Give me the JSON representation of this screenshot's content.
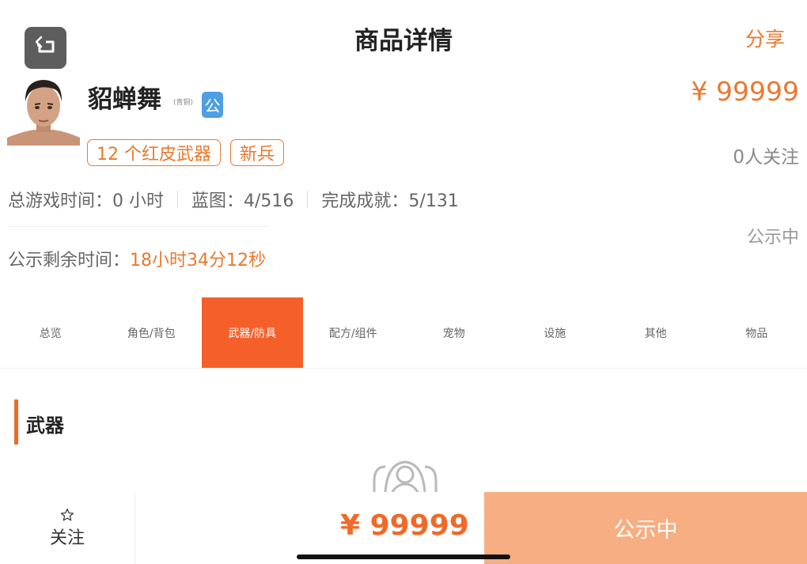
{
  "header": {
    "title": "商品详情",
    "share_label": "分享"
  },
  "profile": {
    "name": "貂蝉舞",
    "rank": "(青铜)",
    "public_badge": "公",
    "price": "¥ 99999",
    "tags": [
      "12 个红皮武器",
      "新兵"
    ],
    "followers": "0人关注"
  },
  "stats": {
    "play_time": "总游戏时间：0 小时",
    "blueprints": "蓝图：4/516",
    "achievements": "完成成就：5/131"
  },
  "status": {
    "side_label": "公示中",
    "remaining_label": "公示剩余时间：",
    "remaining_value": "18小时34分12秒"
  },
  "tabs": [
    {
      "label": "总览",
      "active": false
    },
    {
      "label": "角色/背包",
      "active": false
    },
    {
      "label": "武器/防具",
      "active": true
    },
    {
      "label": "配方/组件",
      "active": false
    },
    {
      "label": "宠物",
      "active": false
    },
    {
      "label": "设施",
      "active": false
    },
    {
      "label": "其他",
      "active": false
    },
    {
      "label": "物品",
      "active": false
    }
  ],
  "section": {
    "title": "武器"
  },
  "bottom_bar": {
    "follow_label": "关注",
    "price": "¥ 99999",
    "status_button": "公示中"
  },
  "colors": {
    "accent": "#e8792f",
    "tab_active": "#f5602a",
    "status_button": "#f7ae82",
    "badge_blue": "#4e9fe3"
  },
  "icons": {
    "back": "back-arrow-icon",
    "follow": "star-icon",
    "empty": "empty-person-icon"
  }
}
